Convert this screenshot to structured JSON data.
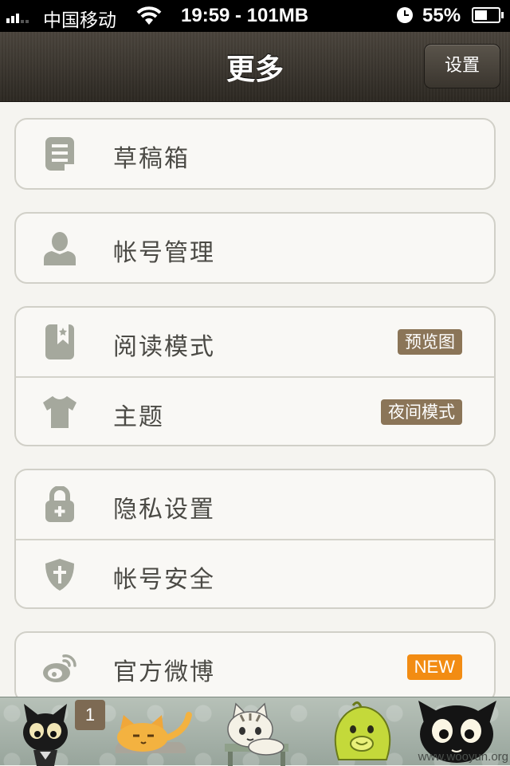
{
  "status_bar": {
    "carrier": "中国移动",
    "time": "19:59 - 101MB",
    "battery": "55%",
    "icons": [
      "signal-icon",
      "wifi-icon",
      "clock-icon",
      "battery-icon"
    ]
  },
  "nav": {
    "title": "更多",
    "settings_label": "设置"
  },
  "groups": [
    {
      "items": [
        {
          "label": "草稿箱",
          "icon": "draft-icon"
        }
      ]
    },
    {
      "items": [
        {
          "label": "帐号管理",
          "icon": "user-icon"
        }
      ]
    },
    {
      "items": [
        {
          "label": "阅读模式",
          "icon": "bookmark-icon",
          "badge": "预览图"
        },
        {
          "label": "主题",
          "icon": "shirt-icon",
          "badge": "夜间模式"
        }
      ]
    },
    {
      "items": [
        {
          "label": "隐私设置",
          "icon": "lock-icon"
        },
        {
          "label": "帐号安全",
          "icon": "shield-icon"
        }
      ]
    },
    {
      "items": [
        {
          "label": "官方微博",
          "icon": "weibo-icon",
          "badge": "NEW"
        }
      ]
    }
  ],
  "tab_bar": {
    "tabs": [
      {
        "icon": "black-cat-icon",
        "badge": "1"
      },
      {
        "icon": "orange-cat-icon"
      },
      {
        "icon": "striped-cat-icon"
      },
      {
        "icon": "green-creature-icon"
      },
      {
        "icon": "black-cat-face-icon"
      }
    ]
  },
  "watermark": "www.wooyun.org",
  "colors": {
    "badge_brown": "#8b7558",
    "badge_new": "#f28c13",
    "icon_gray": "#a5a89d",
    "label_text": "#4b4a45"
  }
}
